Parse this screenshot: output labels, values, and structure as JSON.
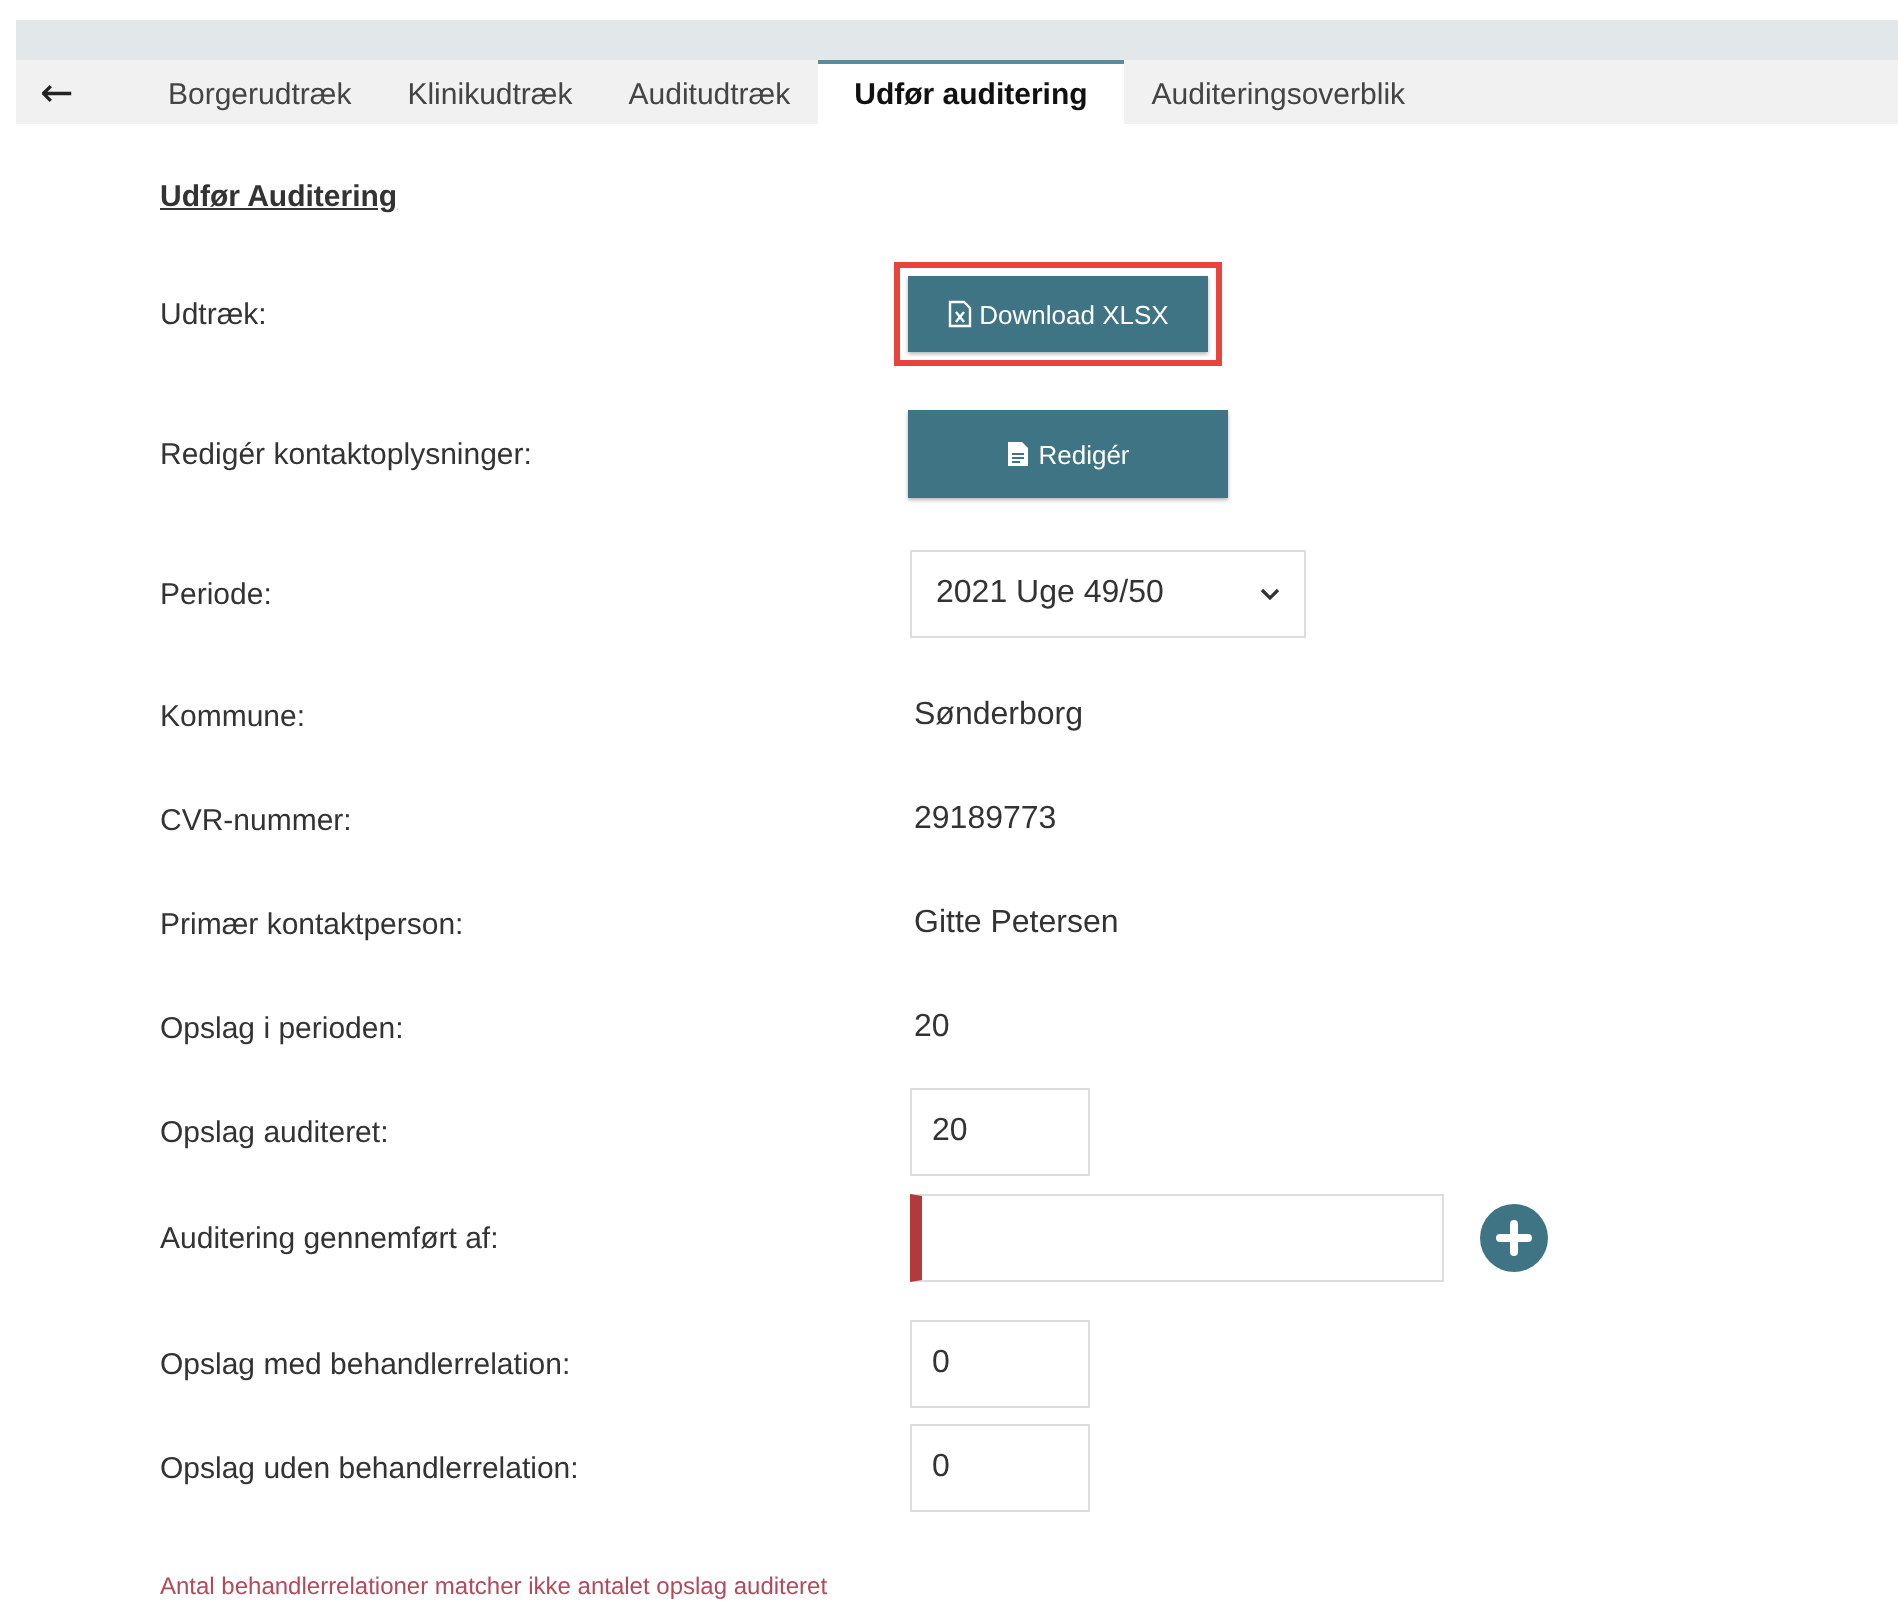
{
  "back_button": {
    "label": "←"
  },
  "tabs": [
    {
      "label": "Borgerudtræk",
      "selected": false
    },
    {
      "label": "Klinikudtræk",
      "selected": false
    },
    {
      "label": "Auditudtræk",
      "selected": false
    },
    {
      "label": "Udfør auditering",
      "selected": true
    },
    {
      "label": "Auditeringsoverblik",
      "selected": false
    }
  ],
  "heading": "Udfør Auditering",
  "rows": [
    {
      "label": "Udtræk:",
      "kind": "button",
      "button": "Download XLSX",
      "highlighted": true
    },
    {
      "label": "Redigér kontaktoplysninger:",
      "kind": "button",
      "button": "Redigér"
    },
    {
      "label": "Periode:",
      "kind": "select",
      "value": "2021 Uge 49/50"
    },
    {
      "label": "Kommune:",
      "kind": "text",
      "value": "Sønderborg"
    },
    {
      "label": "CVR-nummer:",
      "kind": "text",
      "value": "29189773"
    },
    {
      "label": "Primær kontaktperson:",
      "kind": "text",
      "value": "Gitte Petersen"
    },
    {
      "label": "Opslag i perioden:",
      "kind": "text",
      "value": "20"
    },
    {
      "label": "Opslag auditeret:",
      "kind": "input",
      "value": "20"
    },
    {
      "label": "Auditering gennemført af:",
      "kind": "input-add",
      "value": "",
      "invalid": true
    },
    {
      "label": "Opslag med behandlerrelation:",
      "kind": "input",
      "value": "0"
    },
    {
      "label": "Opslag uden behandlerrelation:",
      "kind": "input",
      "value": "0"
    }
  ],
  "error_message": "Antal behandlerrelationer matcher ikke antalet opslag auditeret"
}
